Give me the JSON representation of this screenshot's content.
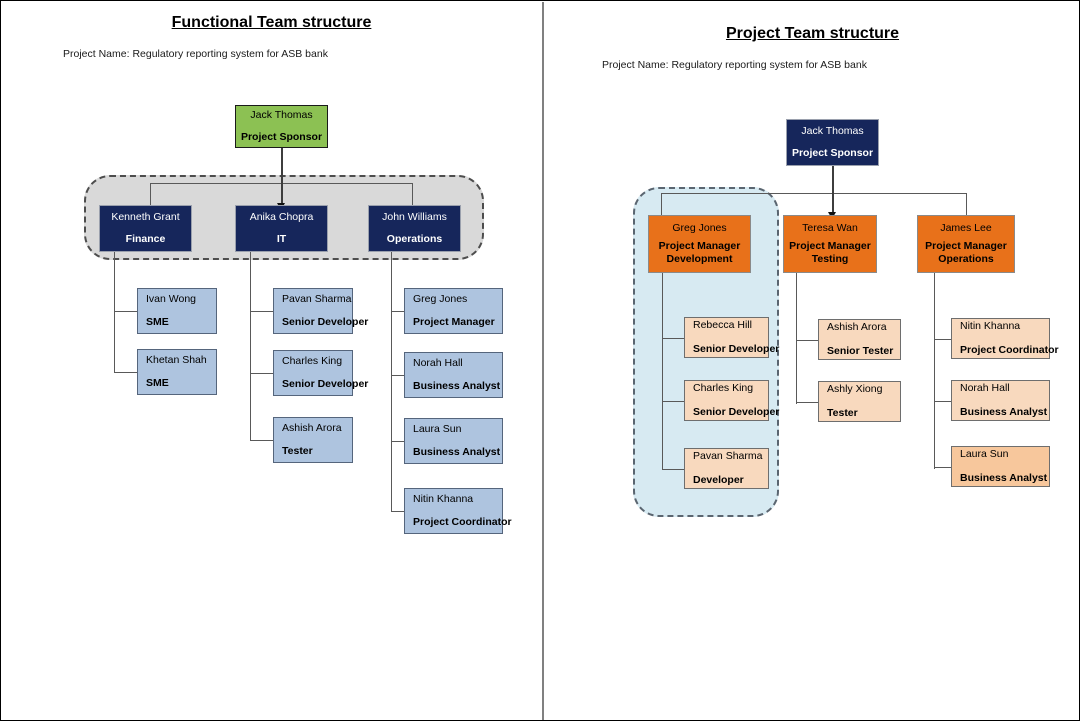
{
  "page": {
    "divider_color": "#808080",
    "border_color": "#000000"
  },
  "left_chart": {
    "title": "Functional Team structure",
    "project_name": "Project Name: Regulatory reporting system for ASB bank",
    "sponsor": {
      "name": "Jack Thomas",
      "role": "Project Sponsor",
      "color": "#8CC153"
    },
    "group_label": "functional-managers-group",
    "managers": [
      {
        "name": "Kenneth Grant",
        "role": "Finance",
        "color": "#16265B"
      },
      {
        "name": "Anika Chopra",
        "role": "IT",
        "color": "#16265B"
      },
      {
        "name": "John Williams",
        "role": "Operations",
        "color": "#16265B"
      }
    ],
    "columns": [
      {
        "manager": "Kenneth Grant",
        "members": [
          {
            "name": "Ivan Wong",
            "role": "SME",
            "color": "#AEC4DF"
          },
          {
            "name": "Khetan Shah",
            "role": "SME",
            "color": "#AEC4DF"
          }
        ]
      },
      {
        "manager": "Anika Chopra",
        "members": [
          {
            "name": "Pavan Sharma",
            "role": "Senior Developer",
            "color": "#AEC4DF"
          },
          {
            "name": "Charles King",
            "role": "Senior Developer",
            "color": "#AEC4DF"
          },
          {
            "name": "Ashish Arora",
            "role": "Tester",
            "color": "#AEC4DF"
          }
        ]
      },
      {
        "manager": "John Williams",
        "members": [
          {
            "name": "Greg Jones",
            "role": "Project Manager",
            "color": "#AEC4DF"
          },
          {
            "name": "Norah Hall",
            "role": "Business Analyst",
            "color": "#AEC4DF"
          },
          {
            "name": "Laura Sun",
            "role": "Business Analyst",
            "color": "#AEC4DF"
          },
          {
            "name": "Nitin Khanna",
            "role": "Project Coordinator",
            "color": "#AEC4DF"
          }
        ]
      }
    ]
  },
  "right_chart": {
    "title": "Project Team structure",
    "project_name": "Project Name: Regulatory reporting system for ASB bank",
    "sponsor": {
      "name": "Jack Thomas",
      "role": "Project Sponsor",
      "color": "#16265B"
    },
    "group_label": "development-team-group",
    "managers": [
      {
        "name": "Greg Jones",
        "role": "Project Manager",
        "role2": "Development",
        "color": "#E8711A"
      },
      {
        "name": "Teresa Wan",
        "role": "Project Manager",
        "role2": "Testing",
        "color": "#E8711A"
      },
      {
        "name": "James Lee",
        "role": "Project Manager",
        "role2": "Operations",
        "color": "#E8711A"
      }
    ],
    "columns": [
      {
        "manager": "Greg Jones",
        "members": [
          {
            "name": "Rebecca Hill",
            "role": "Senior Developer",
            "color": "#F8D9BE"
          },
          {
            "name": "Charles King",
            "role": "Senior Developer",
            "color": "#F8D9BE"
          },
          {
            "name": "Pavan Sharma",
            "role": "Developer",
            "color": "#F8D9BE"
          }
        ]
      },
      {
        "manager": "Teresa Wan",
        "members": [
          {
            "name": "Ashish Arora",
            "role": "Senior Tester",
            "color": "#F8D9BE"
          },
          {
            "name": "Ashly Xiong",
            "role": "Tester",
            "color": "#F8D9BE"
          }
        ]
      },
      {
        "manager": "James Lee",
        "members": [
          {
            "name": "Nitin Khanna",
            "role": "Project Coordinator",
            "color": "#F8D9BE"
          },
          {
            "name": "Norah Hall",
            "role": "Business Analyst",
            "color": "#F8D9BE"
          },
          {
            "name": "Laura Sun",
            "role": "Business Analyst",
            "color": "#F7C79C"
          }
        ]
      }
    ]
  }
}
